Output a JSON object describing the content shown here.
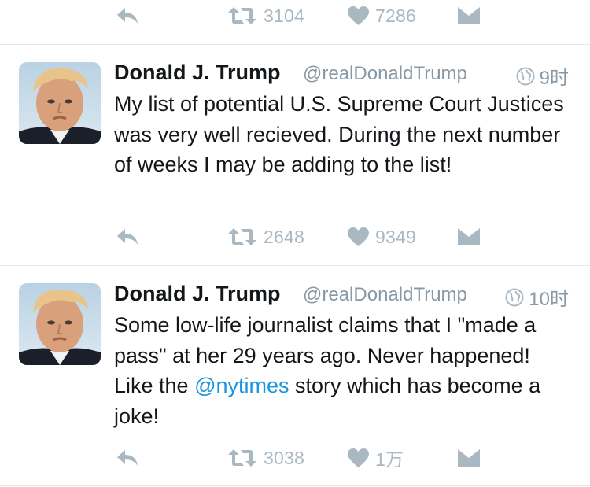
{
  "top_actions": {
    "retweets": "3104",
    "likes": "7286"
  },
  "tweets": [
    {
      "author_name": "Donald J. Trump",
      "author_handle": "@realDonaldTrump",
      "time": "9时",
      "text": "My list of potential U.S. Supreme Court Justices was very well recieved. During the next number of weeks I may be adding to the list!",
      "retweets": "2648",
      "likes": "9349"
    },
    {
      "author_name": "Donald J. Trump",
      "author_handle": "@realDonaldTrump",
      "time": "10时",
      "text_before": "Some low-life journalist claims that I \"made a pass\" at her 29 years ago. Never happened! Like the ",
      "mention": "@nytimes",
      "text_after": " story which has become a joke!",
      "retweets": "3038",
      "likes": "1万"
    }
  ],
  "colors": {
    "action_gray": "#aab8c2",
    "secondary_text": "#8899a6",
    "link_blue": "#1b95e0",
    "divider": "#e1e8ed"
  },
  "icons": [
    "reply-icon",
    "retweet-icon",
    "heart-icon",
    "direct-message-icon",
    "globe-icon"
  ]
}
